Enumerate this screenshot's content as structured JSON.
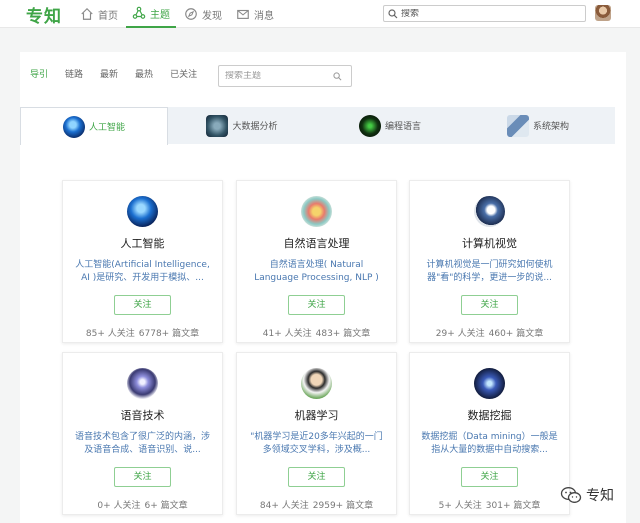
{
  "brand": {
    "logo": "专知"
  },
  "nav": [
    {
      "label": "首页",
      "icon": "home-icon",
      "active": false
    },
    {
      "label": "主题",
      "icon": "topic-network-icon",
      "active": true
    },
    {
      "label": "发现",
      "icon": "compass-icon",
      "active": false
    },
    {
      "label": "消息",
      "icon": "mail-icon",
      "active": false
    }
  ],
  "search": {
    "placeholder": "搜索"
  },
  "filters": [
    "导引",
    "链路",
    "最新",
    "最热",
    "已关注"
  ],
  "topic_search": {
    "placeholder": "搜索主题"
  },
  "categories": [
    {
      "label": "人工智能",
      "active": true
    },
    {
      "label": "大数据分析",
      "active": false
    },
    {
      "label": "编程语言",
      "active": false
    },
    {
      "label": "系统架构",
      "active": false
    }
  ],
  "follow_label": "关注",
  "topics": [
    {
      "name": "人工智能",
      "desc": "人工智能(Artificial Intelligence, AI )是研究、开发用于模拟、...",
      "followers": "85+ 人关注",
      "articles": "6778+ 篇文章"
    },
    {
      "name": "自然语言处理",
      "desc": "自然语言处理( Natural Language Processing, NLP )",
      "followers": "41+ 人关注",
      "articles": "483+ 篇文章"
    },
    {
      "name": "计算机视觉",
      "desc": "计算机视觉是一门研究如何使机器\"看\"的科学，更进一步的说...",
      "followers": "29+ 人关注",
      "articles": "460+ 篇文章"
    },
    {
      "name": "语音技术",
      "desc": "语音技术包含了很广泛的内涵，涉及语音合成、语音识别、说...",
      "followers": "0+ 人关注",
      "articles": "6+ 篇文章"
    },
    {
      "name": "机器学习",
      "desc": "\"机器学习是近20多年兴起的一门多领域交叉学科，涉及概...",
      "followers": "84+ 人关注",
      "articles": "2959+ 篇文章"
    },
    {
      "name": "数据挖掘",
      "desc": "数据挖掘（Data mining）一般是指从大量的数据中自动搜索...",
      "followers": "5+ 人关注",
      "articles": "301+ 篇文章"
    }
  ],
  "watermark": "专知",
  "colors": {
    "accent": "#3fa547",
    "link": "#4a78b0"
  }
}
